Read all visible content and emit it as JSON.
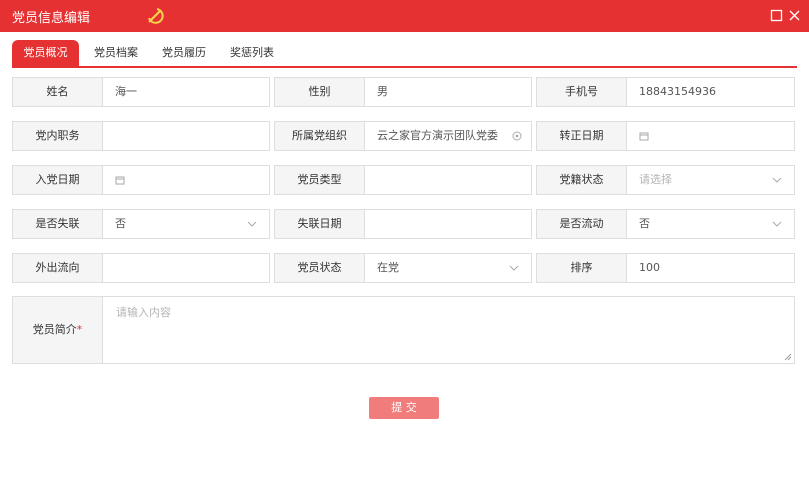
{
  "window": {
    "title": "党员信息编辑"
  },
  "tabs": [
    {
      "label": "党员概况"
    },
    {
      "label": "党员档案"
    },
    {
      "label": "党员履历"
    },
    {
      "label": "奖惩列表"
    }
  ],
  "form": {
    "name": {
      "label": "姓名",
      "value": "海一"
    },
    "gender": {
      "label": "性别",
      "value": "男"
    },
    "phone": {
      "label": "手机号",
      "value": "18843154936"
    },
    "party_position": {
      "label": "党内职务",
      "value": ""
    },
    "party_org": {
      "label": "所属党组织",
      "value": "云之家官方演示团队党委"
    },
    "regular_date": {
      "label": "转正日期",
      "value": ""
    },
    "join_date": {
      "label": "入党日期",
      "value": ""
    },
    "member_type": {
      "label": "党员类型",
      "value": ""
    },
    "membership_status": {
      "label": "党籍状态",
      "placeholder": "请选择"
    },
    "lost_contact": {
      "label": "是否失联",
      "value": "否"
    },
    "lost_contact_date": {
      "label": "失联日期",
      "value": ""
    },
    "floating": {
      "label": "是否流动",
      "value": "否"
    },
    "outflow_direction": {
      "label": "外出流向",
      "value": ""
    },
    "member_status": {
      "label": "党员状态",
      "value": "在党"
    },
    "sort": {
      "label": "排序",
      "value": "100"
    },
    "bio": {
      "label": "党员简介",
      "required_mark": "*",
      "placeholder": "请输入内容"
    }
  },
  "actions": {
    "submit_label": "提 交"
  },
  "colors": {
    "accent": "#e53131",
    "submit_bg": "#f07c7c",
    "label_bg": "#f5f5f5",
    "border": "#dedede"
  }
}
